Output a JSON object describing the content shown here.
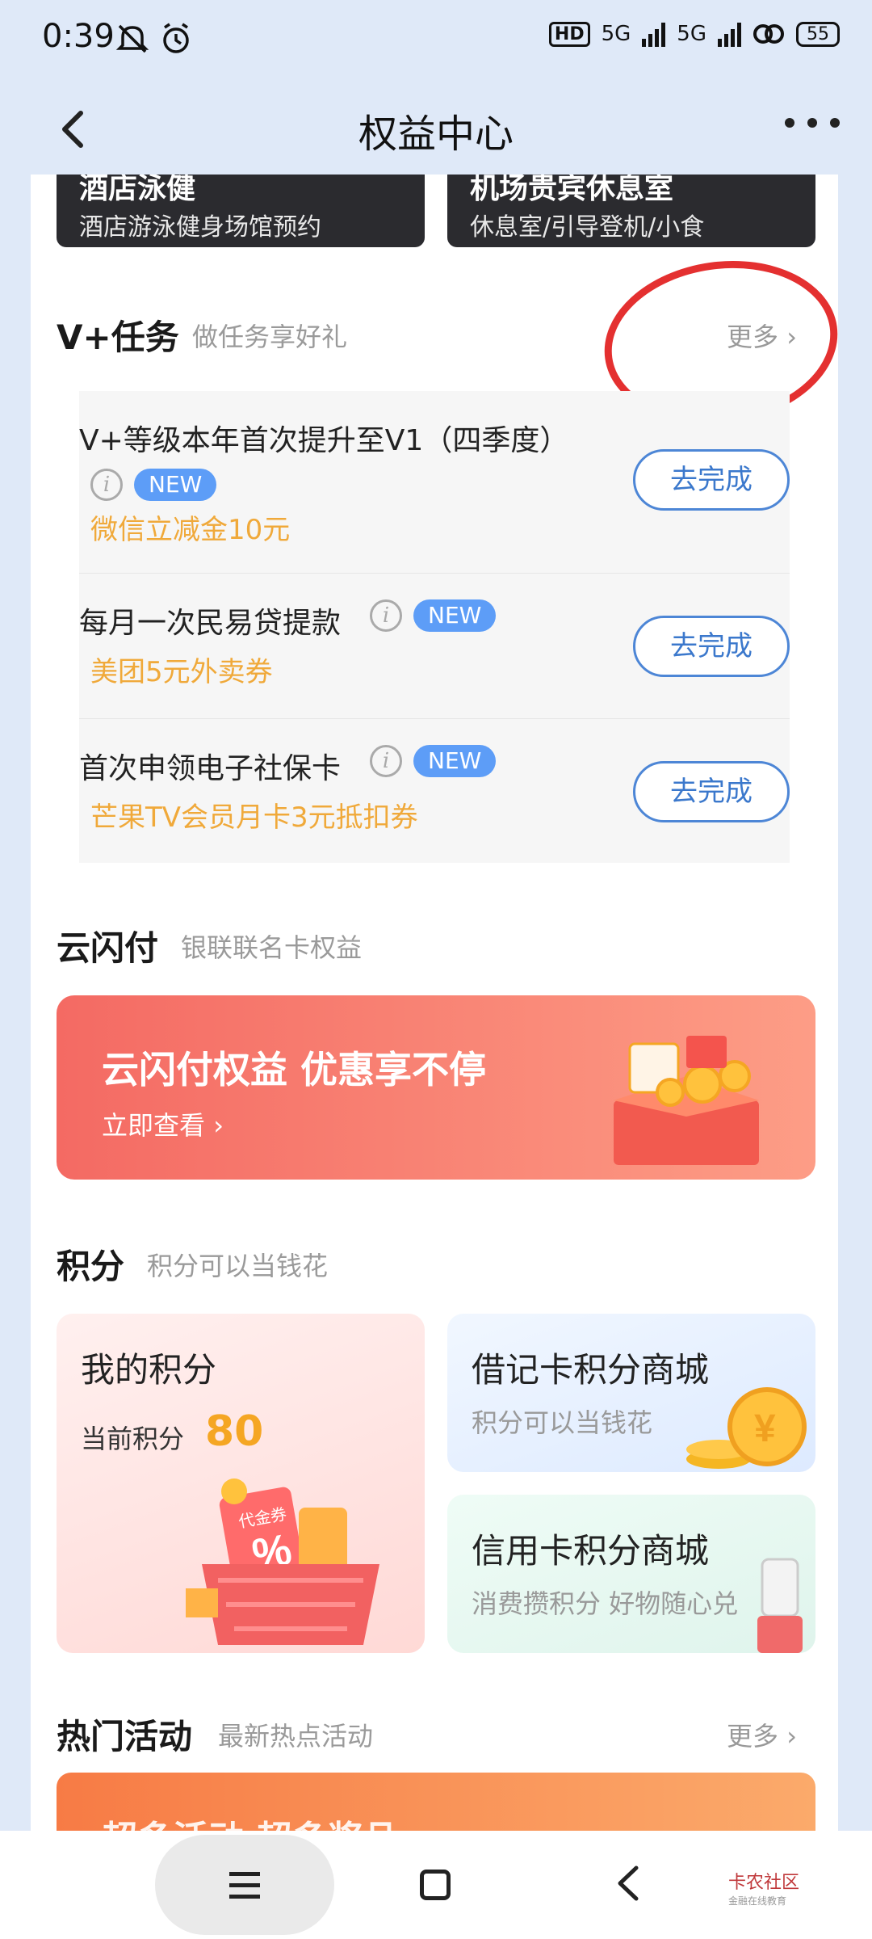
{
  "status": {
    "time": "0:39",
    "hd": "HD",
    "net1": "5G",
    "net2": "5G",
    "battery": "55"
  },
  "header": {
    "title": "权益中心"
  },
  "top_cards": [
    {
      "title": "酒店泳健",
      "subtitle": "酒店游泳健身场馆预约"
    },
    {
      "title": "机场贵宾休息室",
      "subtitle": "休息室/引导登机/小食"
    }
  ],
  "vtasks": {
    "title": "V+任务",
    "subtitle": "做任务享好礼",
    "more": "更多",
    "items": [
      {
        "title": "V+等级本年首次提升至V1（四季度）",
        "badge": "NEW",
        "reward": "微信立减金10元",
        "button": "去完成"
      },
      {
        "title": "每月一次民易贷提款",
        "badge": "NEW",
        "reward": "美团5元外卖券",
        "button": "去完成"
      },
      {
        "title": "首次申领电子社保卡",
        "badge": "NEW",
        "reward": "芒果TV会员月卡3元抵扣券",
        "button": "去完成"
      }
    ]
  },
  "ysf": {
    "title": "云闪付",
    "subtitle": "银联联名卡权益",
    "banner_title": "云闪付权益 优惠享不停",
    "banner_link": "立即查看"
  },
  "points": {
    "title": "积分",
    "subtitle": "积分可以当钱花",
    "my_points_title": "我的积分",
    "current_label": "当前积分",
    "current_value": "80",
    "debit_mall_title": "借记卡积分商城",
    "debit_mall_sub": "积分可以当钱花",
    "credit_mall_title": "信用卡积分商城",
    "credit_mall_sub": "消费攒积分 好物随心兑",
    "coupon_text": "代金券"
  },
  "hot": {
    "title": "热门活动",
    "subtitle": "最新热点活动",
    "more": "更多",
    "banner_text": "超多活动 超多奖品"
  },
  "watermark": {
    "name": "卡农社区",
    "tagline": "金融在线教育"
  }
}
